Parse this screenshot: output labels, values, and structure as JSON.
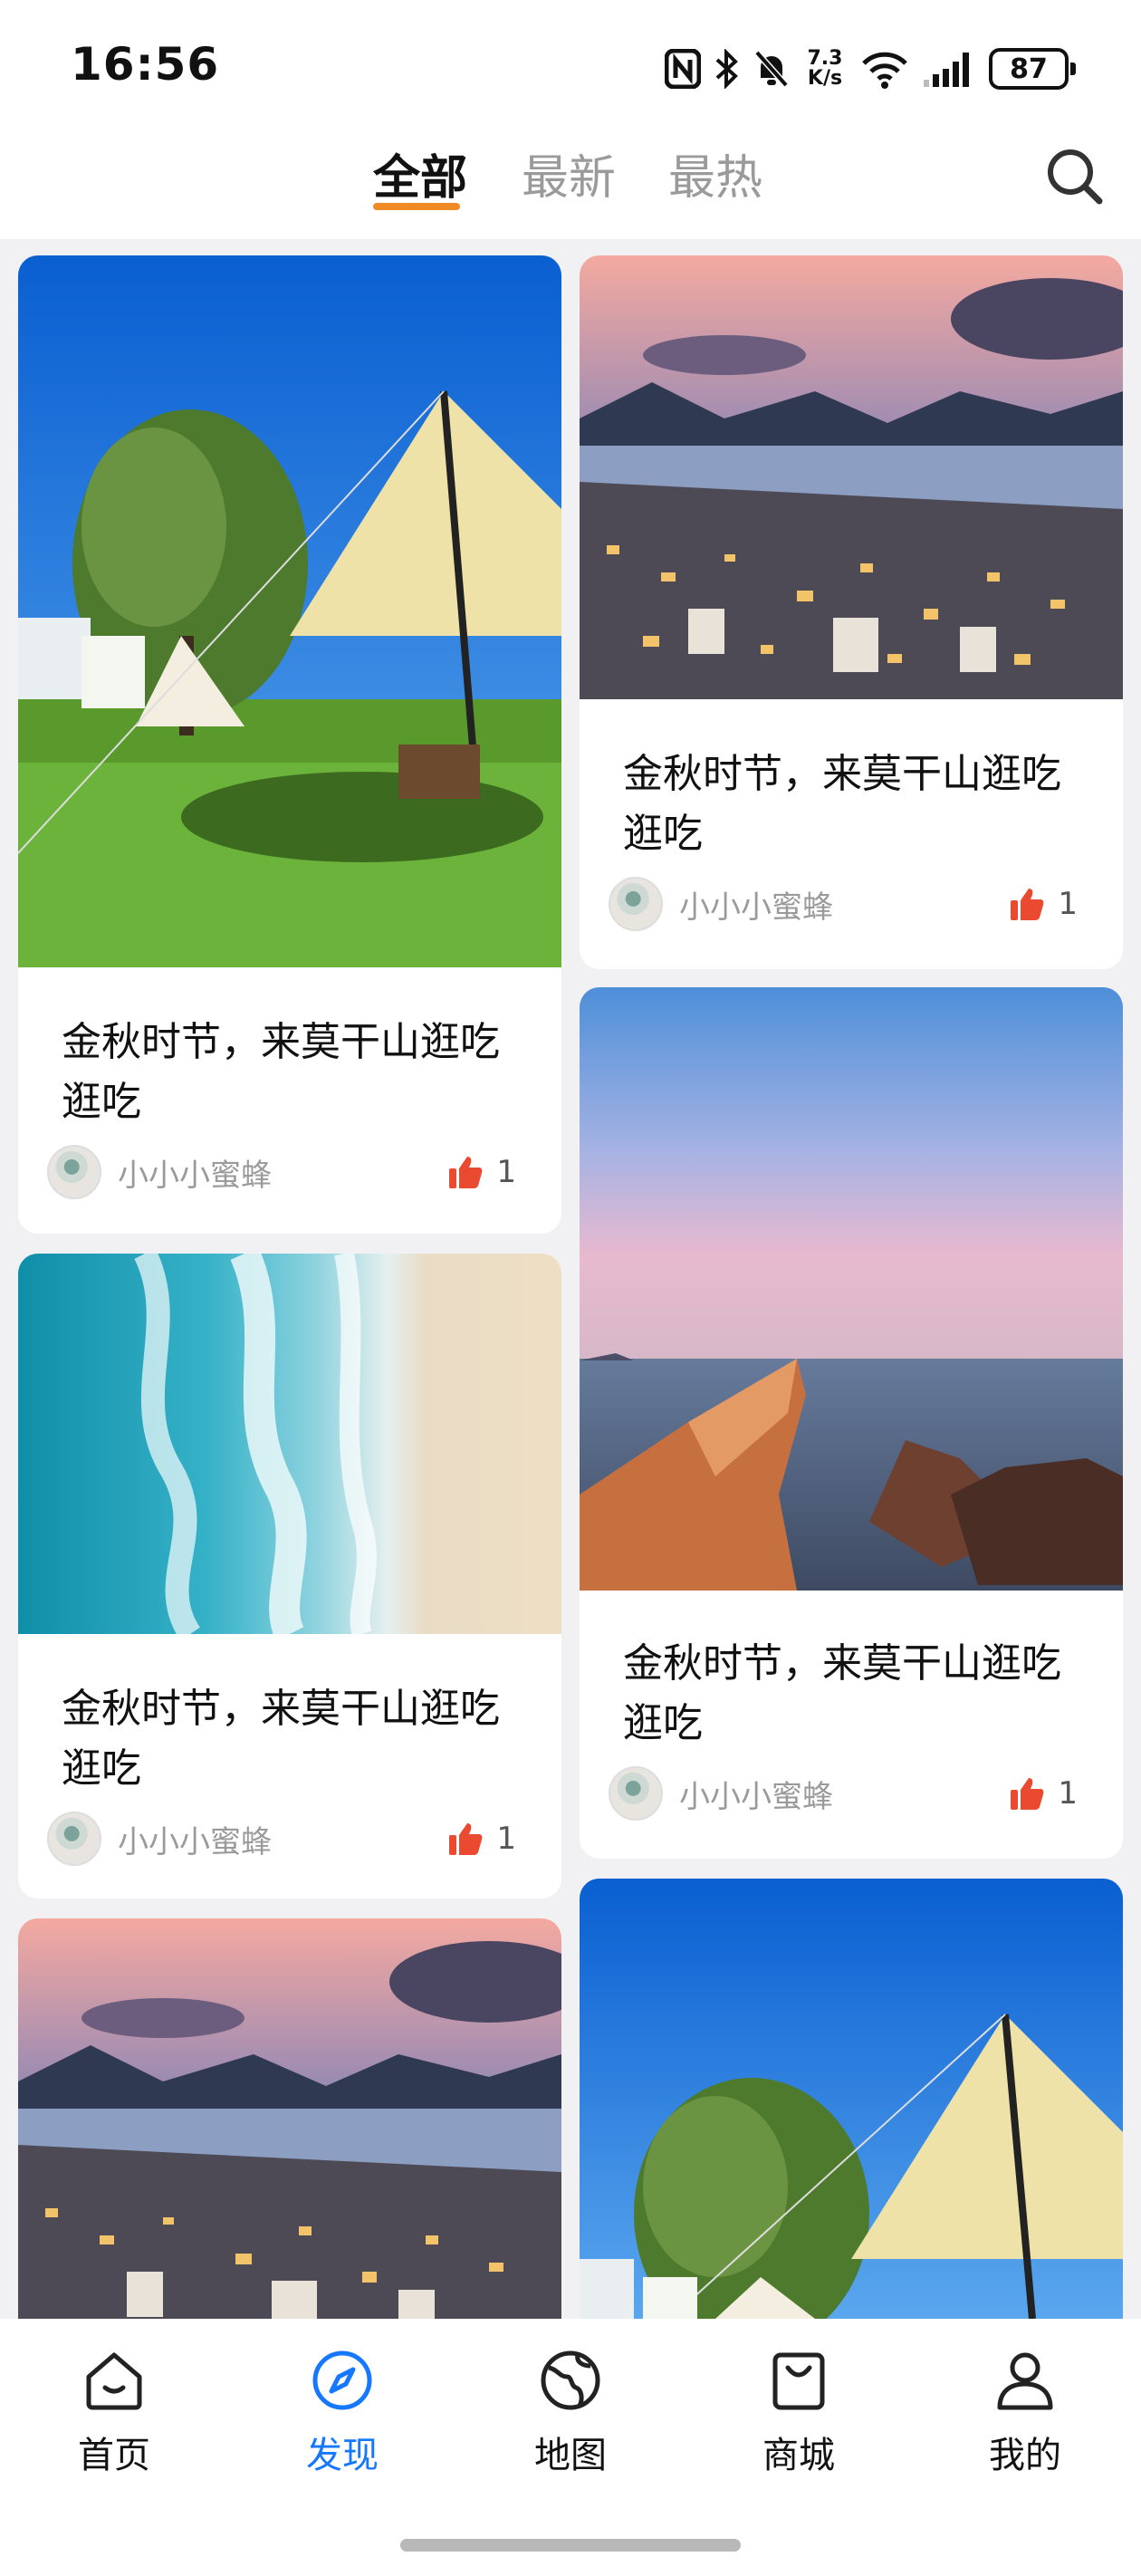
{
  "status_bar": {
    "time": "16:56",
    "net_speed_value": "7.3",
    "net_speed_unit": "K/s",
    "battery": "87",
    "icons": [
      "nfc-icon",
      "bluetooth-icon",
      "mute-bell-icon",
      "wifi-icon",
      "signal-icon",
      "battery-icon"
    ]
  },
  "tabs": [
    {
      "label": "全部",
      "active": true
    },
    {
      "label": "最新",
      "active": false
    },
    {
      "label": "最热",
      "active": false
    }
  ],
  "cards": [
    {
      "title": "金秋时节，来莫干山逛吃逛吃",
      "author": "小小小蜜蜂",
      "likes": "1",
      "image": "campsite-tent-willow"
    },
    {
      "title": "金秋时节，来莫干山逛吃逛吃",
      "author": "小小小蜜蜂",
      "likes": "1",
      "image": "harbor-city-sunset"
    },
    {
      "title": "金秋时节，来莫干山逛吃逛吃",
      "author": "小小小蜜蜂",
      "likes": "1",
      "image": "aerial-beach-waves"
    },
    {
      "title": "金秋时节，来莫干山逛吃逛吃",
      "author": "小小小蜜蜂",
      "likes": "1",
      "image": "sea-rocks-dusk"
    },
    {
      "title": "",
      "author": "",
      "likes": "",
      "image": "harbor-city-sunset"
    },
    {
      "title": "",
      "author": "",
      "likes": "",
      "image": "campsite-tent-willow"
    }
  ],
  "bottom_nav": [
    {
      "label": "首页",
      "icon": "home-icon",
      "active": false
    },
    {
      "label": "发现",
      "icon": "compass-icon",
      "active": true
    },
    {
      "label": "地图",
      "icon": "globe-icon",
      "active": false
    },
    {
      "label": "商城",
      "icon": "shopping-bag-icon",
      "active": false
    },
    {
      "label": "我的",
      "icon": "user-icon",
      "active": false
    }
  ],
  "colors": {
    "accent": "#1677ff",
    "tab_indicator": "#f08a24",
    "like": "#ea4a2f"
  }
}
